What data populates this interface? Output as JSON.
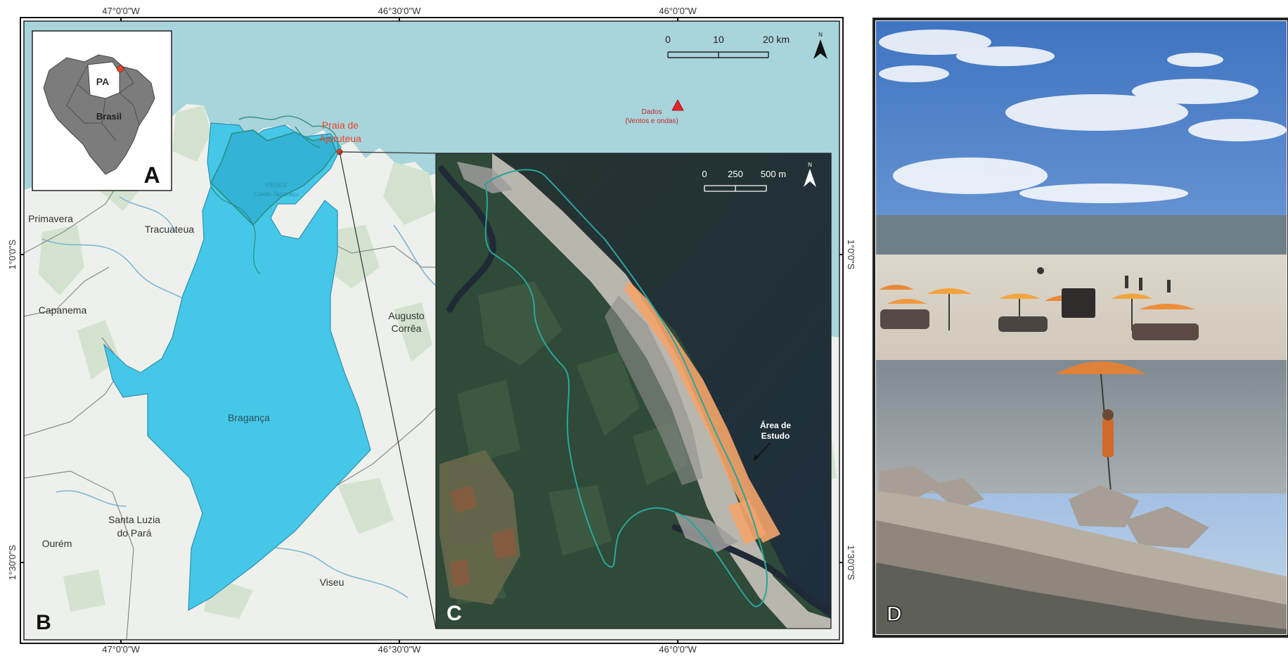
{
  "coords": {
    "top": [
      "47°0'0\"W",
      "46°30'0\"W",
      "46°0'0\"W"
    ],
    "bottom": [
      "47°0'0\"W",
      "46°30'0\"W",
      "46°0'0\"W"
    ],
    "left": [
      "1°0'0\"S",
      "1°30'0\"S"
    ],
    "right": [
      "1°0'0\"S",
      "1°30'0\"S"
    ]
  },
  "panels": {
    "a": "A",
    "b": "B",
    "c": "C",
    "d": "D"
  },
  "inset_a": {
    "state": "PA",
    "country": "Brasil"
  },
  "scale_b": {
    "ticks": [
      "0",
      "10",
      "20 km"
    ]
  },
  "scale_c": {
    "ticks": [
      "0",
      "250",
      "500 m"
    ]
  },
  "north": "N",
  "data_point": {
    "line1": "Dados",
    "line2": "(Ventos e ondas)",
    "color": "#e8242b"
  },
  "beach": {
    "line1": "Praia de",
    "line2": "Ajuruteua",
    "color": "#e8472b"
  },
  "resex": {
    "line1": "RESEX",
    "line2": "Caeté-Taperaçu"
  },
  "municipalities": {
    "primavera": "Primavera",
    "tracuateua": "Tracuateua",
    "capanema": "Capanema",
    "augusto1": "Augusto",
    "augusto2": "Corrêa",
    "braganca": "Bragança",
    "santaluzia1": "Santa Luzia",
    "santaluzia2": "do Pará",
    "ourem": "Ourém",
    "viseu": "Viseu"
  },
  "study_area": {
    "line1": "Área de",
    "line2": "Estudo",
    "color": "#f4a46a"
  },
  "colors": {
    "sea": "#a8d4db",
    "braganca": "#45c8e8",
    "land": "#f1f3ef",
    "panel_frame": "#222222"
  }
}
